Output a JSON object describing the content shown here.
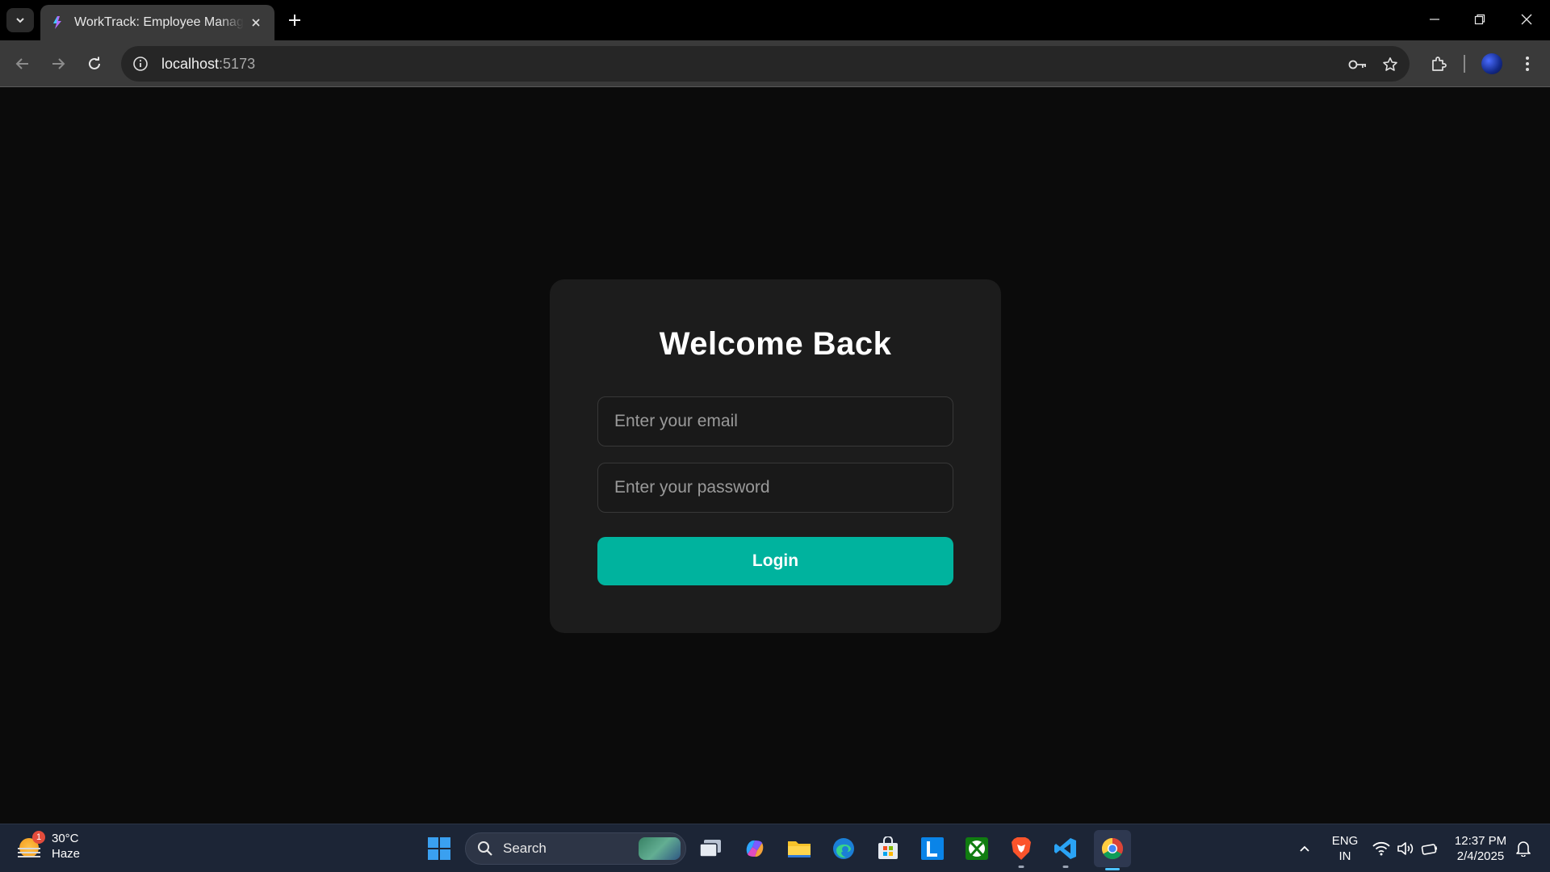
{
  "browser": {
    "tab_title": "WorkTrack: Employee Management",
    "url_host": "localhost",
    "url_port": ":5173"
  },
  "login": {
    "title": "Welcome Back",
    "email_placeholder": "Enter your email",
    "password_placeholder": "Enter your password",
    "submit_label": "Login",
    "accent_color": "#00b39e"
  },
  "taskbar": {
    "weather_temp": "30°C",
    "weather_condition": "Haze",
    "weather_badge": "1",
    "search_label": "Search",
    "language": "ENG",
    "region": "IN",
    "time": "12:37 PM",
    "date": "2/4/2025",
    "pinned_apps": [
      "start-icon",
      "task-view-icon",
      "copilot-icon",
      "file-explorer-icon",
      "edge-icon",
      "store-icon",
      "l-app-icon",
      "xbox-icon",
      "brave-icon",
      "vscode-icon",
      "chrome-icon"
    ]
  }
}
